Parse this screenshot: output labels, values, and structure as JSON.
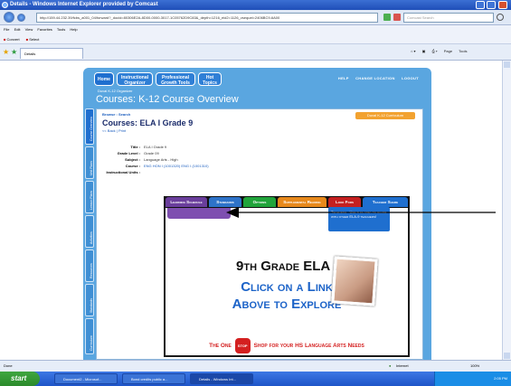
{
  "window": {
    "title": "Details - Windows Internet Explorer provided by Comcast"
  },
  "browser": {
    "address": "http://159.44.232.39/fcbs_a001_04/forward?_docid=80306E2A-8D00-0000-3017-1C05762D9C83&_depth=1216_eid2=1126_vsequel=2406BC9-6A00",
    "search_placeholder": "Comcast Search",
    "menu": [
      "File",
      "Edit",
      "View",
      "Favorites",
      "Tools",
      "Help"
    ],
    "links": {
      "convert": "Convert",
      "select": "Select"
    },
    "tab_label": "Details",
    "tab_tools": [
      "Page",
      "Tools"
    ],
    "status_left": "Done",
    "status_zone": "Internet",
    "zoom": "100%"
  },
  "site": {
    "nav": [
      "Home",
      "Instructional Organizer",
      "Professional Growth Tools",
      "Hot Topics"
    ],
    "util_links": [
      "HELP",
      "CHANGE LOCATION",
      "LOGOUT"
    ],
    "top_crumb": "Duval K-12 Organizer",
    "page_title": "Courses: K-12 Course Overview",
    "rail_tabs": [
      "Course Overview",
      "Unit Plans",
      "Lesson Plans",
      "Activities",
      "Resources",
      "Standards",
      "Curriculum"
    ],
    "browse": "Browse : Search",
    "back_links": "<< Back | Print",
    "curriculum_badge": "Duval K-12 Curriculum",
    "course_heading": "Courses: ELA I Grade 9",
    "details": [
      {
        "label": "Title :",
        "value": "ELA I Grade 9"
      },
      {
        "label": "Grade Level :",
        "value": "Grade 09"
      },
      {
        "label": "Subject :",
        "value": "Language Arts - High"
      },
      {
        "label": "Course :",
        "value": "ENG HON I (1001320) ENG I (1001310)"
      },
      {
        "label": "Instructional Units :",
        "value": ""
      }
    ]
  },
  "course_tabs": [
    {
      "label": "Learning Schedule",
      "color": "#6a3e9c"
    },
    {
      "label": "Standards",
      "color": "#2e73c9"
    },
    {
      "label": "Options",
      "color": "#21a43b"
    },
    {
      "label": "Supplemental Reading",
      "color": "#e7891c"
    },
    {
      "label": "Look Fors",
      "color": "#c52020"
    },
    {
      "label": "Teacher Share",
      "color": "#1f6fcf"
    }
  ],
  "teacher_note": "Teachers - Use this area to share with other ELA-9 teachers!",
  "promo": {
    "line1": "9th Grade ELA I",
    "line2a": "Click on a Link",
    "line2b": "Above to Explore",
    "banner_left": "The One",
    "stop": "STOP",
    "banner_right": "Shop for your HS Language Arts Needs"
  },
  "taskbar": {
    "start": "start",
    "buttons": [
      "Document2 - Microsof...",
      "Bond credits public a...",
      "Details - Windows Int..."
    ],
    "clock": "2:05 PM"
  }
}
